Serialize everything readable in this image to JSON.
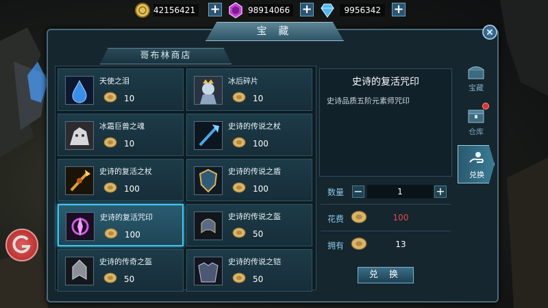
{
  "currency": {
    "gold": {
      "value": "42156421",
      "icon": "gold-coin-icon",
      "color": "#e2c15a"
    },
    "gem": {
      "value": "98914066",
      "icon": "purple-gem-icon",
      "color": "#c23fd0"
    },
    "diamond": {
      "value": "9956342",
      "icon": "diamond-icon",
      "color": "#4fb8f0"
    },
    "plus_label": "+"
  },
  "window": {
    "title": "宝 藏",
    "close_label": "✕"
  },
  "shop": {
    "tab_label": "哥布林商店",
    "items": [
      {
        "name": "天使之泪",
        "price": "10",
        "icon": "angel-tear-icon"
      },
      {
        "name": "冰后碎片",
        "price": "10",
        "icon": "ice-queen-icon"
      },
      {
        "name": "冰霜巨兽之魂",
        "price": "10",
        "icon": "frost-beast-icon"
      },
      {
        "name": "史诗的传说之杖",
        "price": "100",
        "icon": "legend-staff-icon"
      },
      {
        "name": "史诗的复活之杖",
        "price": "100",
        "icon": "revive-staff-icon"
      },
      {
        "name": "史诗的传说之盾",
        "price": "100",
        "icon": "legend-shield-icon"
      },
      {
        "name": "史诗的复活咒印",
        "price": "100",
        "icon": "revive-seal-icon"
      },
      {
        "name": "史诗的传说之盔",
        "price": "50",
        "icon": "legend-helm-icon"
      },
      {
        "name": "史诗的传奇之盔",
        "price": "50",
        "icon": "epic-helm-icon"
      },
      {
        "name": "史诗的传说之铠",
        "price": "50",
        "icon": "legend-armor-icon"
      }
    ]
  },
  "detail": {
    "title": "史诗的复活咒印",
    "description": "史诗品质五阶元素师咒印",
    "quantity_label": "数量",
    "quantity": "1",
    "minus_label": "−",
    "plus_label": "+",
    "cost_label": "花费",
    "cost": "100",
    "own_label": "拥有",
    "owned": "13",
    "exchange_button": "兑 换"
  },
  "side_tabs": [
    {
      "label": "宝藏",
      "icon": "treasure-chest-icon",
      "active": false
    },
    {
      "label": "仓库",
      "icon": "warehouse-chest-icon",
      "active": false
    },
    {
      "label": "兑换",
      "icon": "exchange-hand-icon",
      "active": true
    }
  ],
  "colors": {
    "accent": "#46c5ee",
    "cost_red": "#e24a4a",
    "label_blue": "#8ac8e8"
  }
}
